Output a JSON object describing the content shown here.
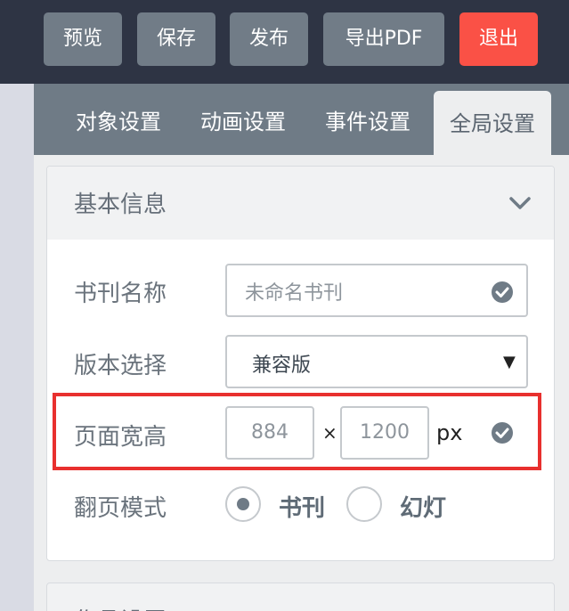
{
  "toolbar": {
    "preview_label": "预览",
    "save_label": "保存",
    "publish_label": "发布",
    "export_pdf_label": "导出PDF",
    "exit_label": "退出",
    "exit_color": "#fa5146"
  },
  "tabs": [
    {
      "label": "对象设置",
      "active": false
    },
    {
      "label": "动画设置",
      "active": false
    },
    {
      "label": "事件设置",
      "active": false
    },
    {
      "label": "全局设置",
      "active": true
    }
  ],
  "basic_info": {
    "title": "基本信息",
    "book_name": {
      "label": "书刊名称",
      "placeholder": "未命名书刊"
    },
    "version": {
      "label": "版本选择",
      "value": "兼容版"
    },
    "page_size": {
      "label": "页面宽高",
      "width": "884",
      "height": "1200",
      "separator": "×",
      "unit": "px"
    },
    "flip_mode": {
      "label": "翻页模式",
      "options": [
        "书刊",
        "幻灯"
      ],
      "selected": "书刊"
    }
  },
  "next_section": {
    "title": "作品设置"
  },
  "highlight_color": "#e8302e"
}
